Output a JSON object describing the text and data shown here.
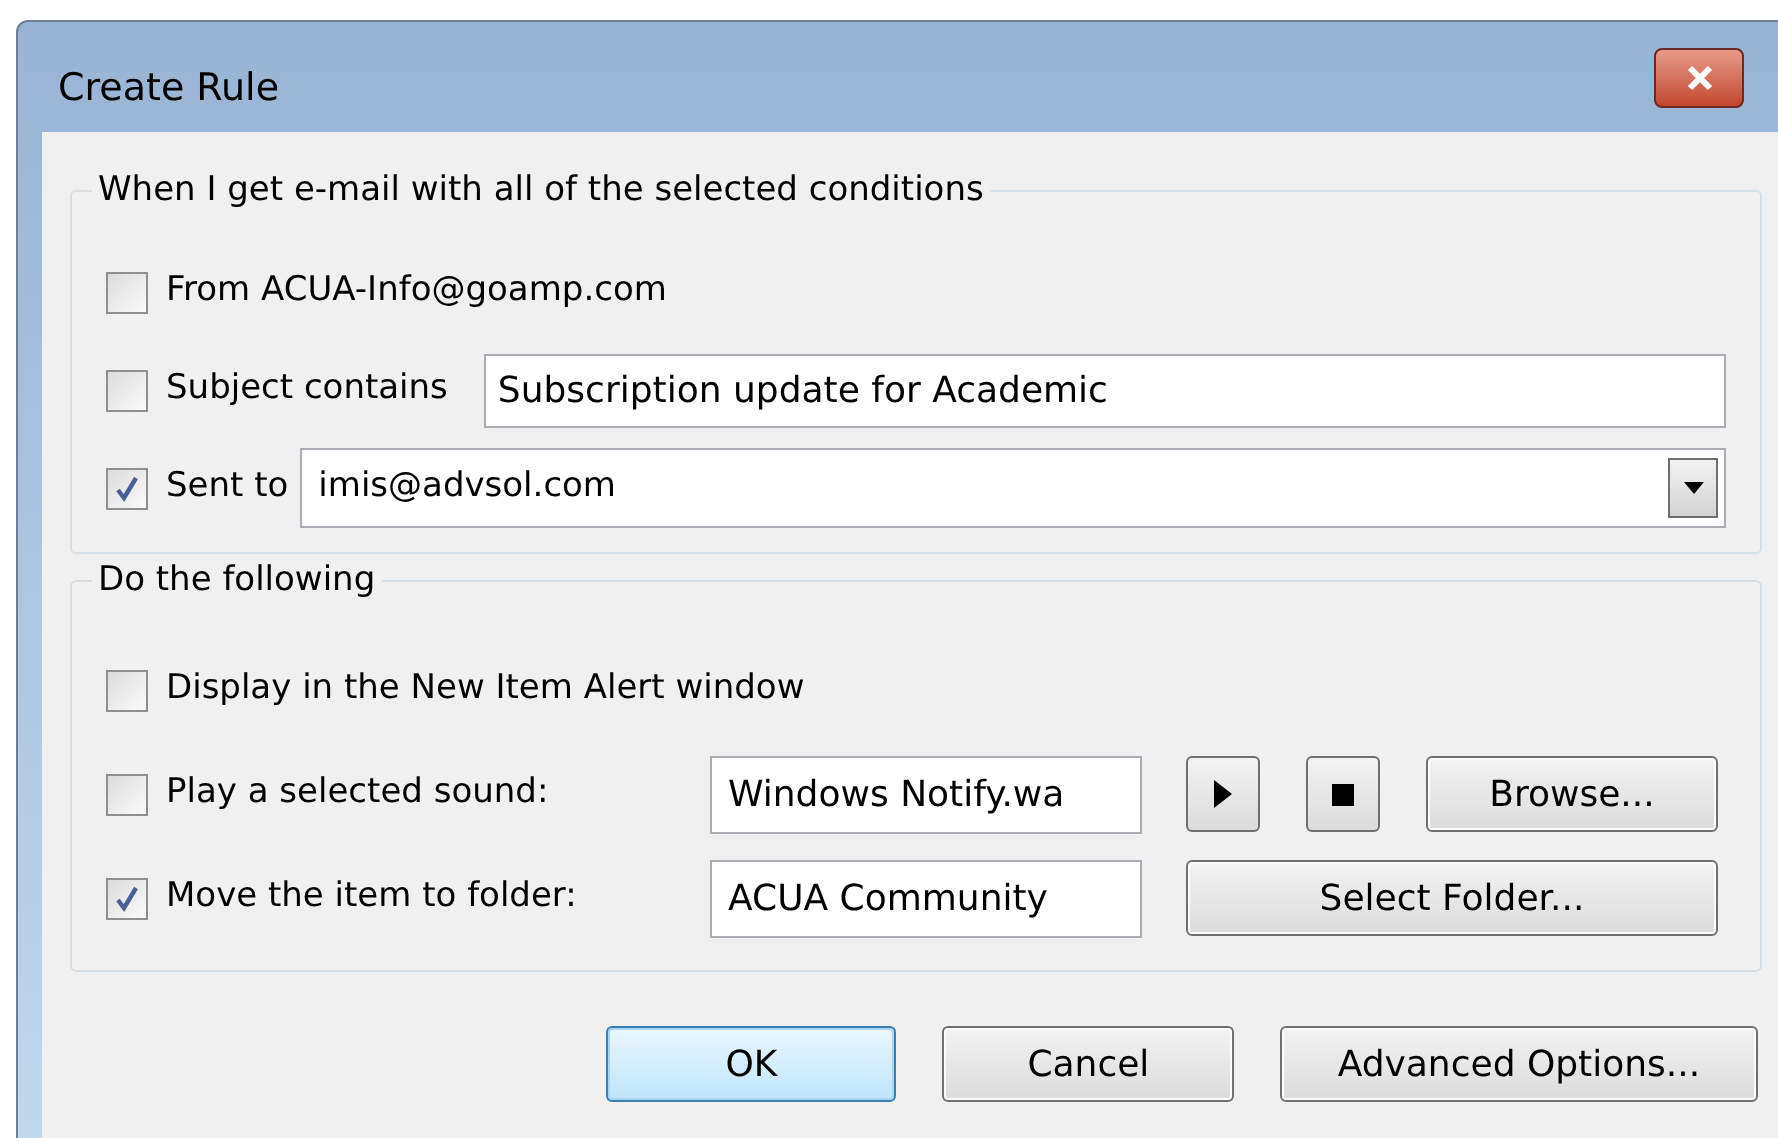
{
  "window": {
    "title": "Create Rule"
  },
  "conditions": {
    "heading": "When I get e-mail with all of the selected conditions",
    "items": [
      {
        "kind": "checkbox",
        "label": "From ACUA-Info@goamp.com",
        "checked": false
      },
      {
        "kind": "text",
        "label": "Subject contains",
        "checked": false,
        "value": "Subscription update for Academic"
      },
      {
        "kind": "dropdown",
        "label": "Sent to",
        "checked": true,
        "value": "imis@advsol.com"
      }
    ]
  },
  "actions": {
    "heading": "Do the following",
    "items": [
      {
        "kind": "checkbox",
        "label": "Display in the New Item Alert window",
        "checked": false
      },
      {
        "kind": "sound",
        "label": "Play a selected sound:",
        "checked": false,
        "value": "Windows Notify.wa",
        "button": "Browse..."
      },
      {
        "kind": "folder",
        "label": "Move the item to folder:",
        "checked": true,
        "value": "ACUA Community",
        "button": "Select Folder..."
      }
    ]
  },
  "buttons": [
    {
      "label": "OK",
      "default": true
    },
    {
      "label": "Cancel",
      "default": false
    },
    {
      "label": "Advanced Options...",
      "default": false
    }
  ]
}
